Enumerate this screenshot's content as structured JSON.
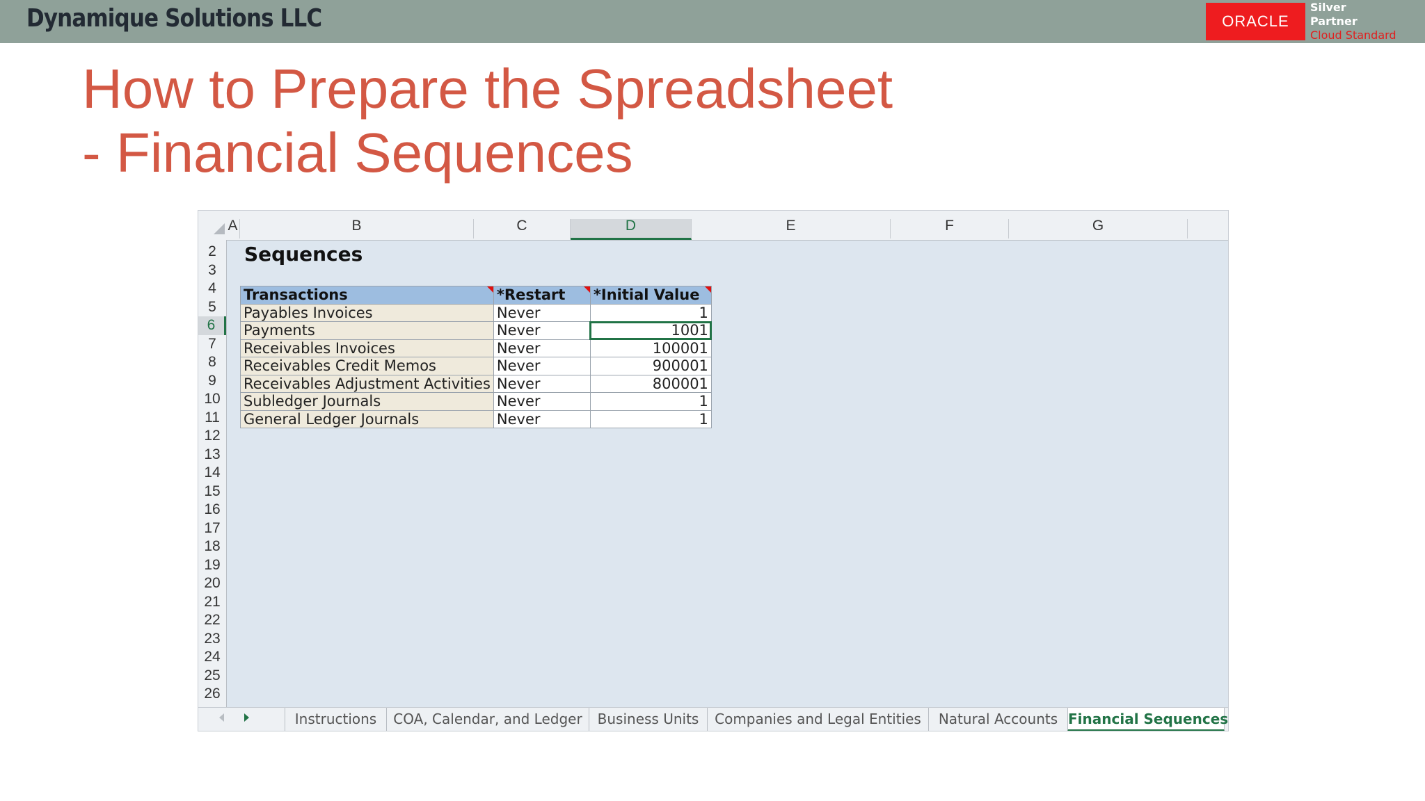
{
  "header": {
    "company": "Dynamique Solutions LLC",
    "oracle_logo": "ORACLE",
    "partner_lines": [
      "Silver",
      "Partner",
      "Cloud Standard"
    ]
  },
  "slide": {
    "title_line1": "How to Prepare the Spreadsheet",
    "title_line2": "- Financial Sequences"
  },
  "sheet": {
    "columns": [
      "A",
      "B",
      "C",
      "D",
      "E",
      "F",
      "G"
    ],
    "selected_column": "D",
    "rows": [
      "2",
      "3",
      "4",
      "5",
      "6",
      "7",
      "8",
      "9",
      "10",
      "11",
      "12",
      "13",
      "14",
      "15",
      "16",
      "17",
      "18",
      "19",
      "20",
      "21",
      "22",
      "23",
      "24",
      "25",
      "26"
    ],
    "selected_row": "6",
    "title": "Sequences",
    "table": {
      "headers": [
        "Transactions",
        "*Restart",
        "*Initial Value"
      ],
      "rows": [
        [
          "Payables Invoices",
          "Never",
          "1"
        ],
        [
          "Payments",
          "Never",
          "1001"
        ],
        [
          "Receivables Invoices",
          "Never",
          "100001"
        ],
        [
          "Receivables Credit Memos",
          "Never",
          "900001"
        ],
        [
          "Receivables Adjustment Activities",
          "Never",
          "800001"
        ],
        [
          "Subledger Journals",
          "Never",
          "1"
        ],
        [
          "General Ledger Journals",
          "Never",
          "1"
        ]
      ]
    },
    "tabs": [
      "Instructions",
      "COA, Calendar, and Ledger",
      "Business Units",
      "Companies and Legal Entities",
      "Natural Accounts",
      "Financial Sequences"
    ],
    "active_tab": "Financial Sequences"
  },
  "colors": {
    "header_bar": "#8fa199",
    "title": "#d35844",
    "oracle_red": "#ee1c1f",
    "excel_green": "#217346",
    "table_header": "#9dbde0"
  }
}
